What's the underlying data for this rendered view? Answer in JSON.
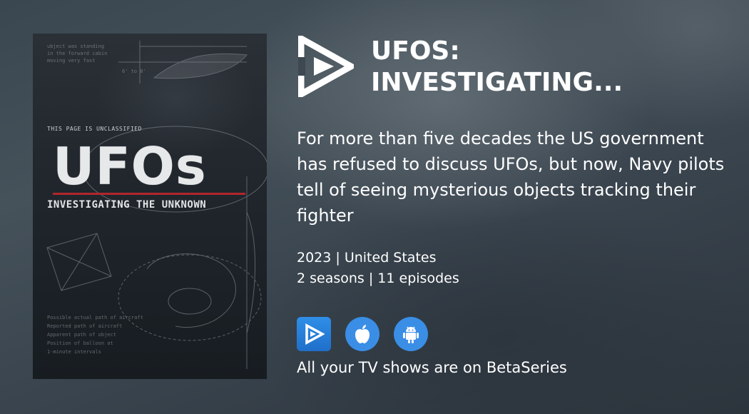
{
  "poster": {
    "classified_text": "THIS PAGE IS UNCLASSIFIED",
    "title": "UFOs",
    "subtitle": "INVESTIGATING THE UNKNOWN"
  },
  "logo": {
    "icon": "betaseries-logo-icon"
  },
  "show": {
    "title_line1": "UFOS:",
    "title_line2": "INVESTIGATING..."
  },
  "description": "For more than five decades the US government has refused to discuss UFOs, but now, Navy pilots tell of seeing mysterious objects tracking their fighter",
  "meta": {
    "year_country": "2023 | United States",
    "seasons_episodes": "2 seasons | 11 episodes"
  },
  "apps": [
    {
      "icon": "betaseries-app-icon"
    },
    {
      "icon": "apple-icon"
    },
    {
      "icon": "android-icon"
    }
  ],
  "tagline": "All your TV shows are on BetaSeries",
  "colors": {
    "app_blue": "#3a8ee6",
    "poster_red_line": "#b0262c"
  }
}
